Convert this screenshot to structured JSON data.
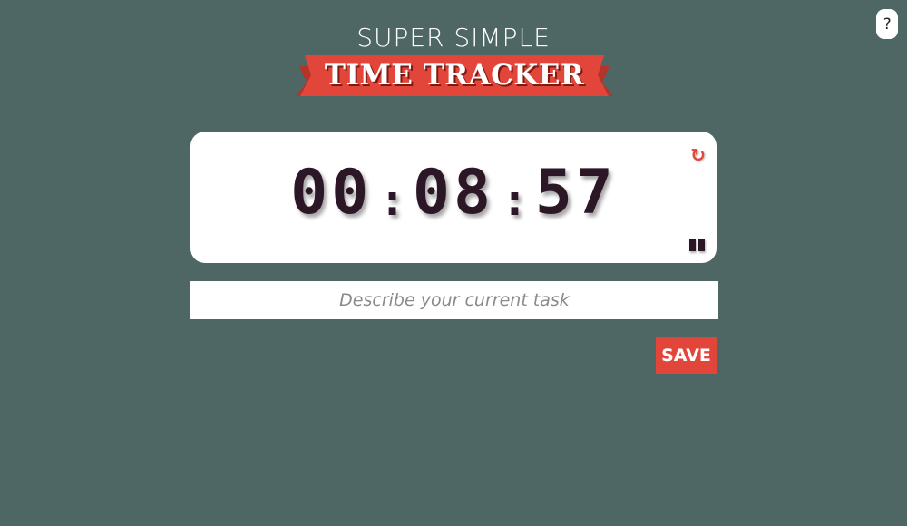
{
  "help": {
    "label": "?"
  },
  "header": {
    "subtitle": "SUPER SIMPLE",
    "title": "TIME TRACKER"
  },
  "timer": {
    "hours": "00",
    "minutes": "08",
    "seconds": "57",
    "separator": ":",
    "reset_icon": "↻",
    "pause_icon": "pause-icon"
  },
  "task": {
    "value": "",
    "placeholder": "Describe your current task"
  },
  "actions": {
    "save_label": "SAVE"
  },
  "colors": {
    "background": "#4e6764",
    "accent": "#e2463a",
    "card": "#ffffff",
    "digits": "#2b1726"
  }
}
